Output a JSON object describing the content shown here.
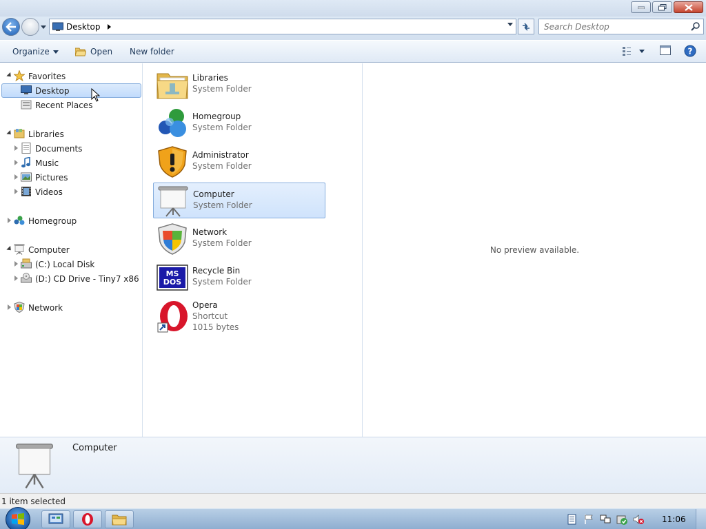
{
  "window": {
    "caption_buttons": [
      "minimize",
      "maximize",
      "close"
    ]
  },
  "address": {
    "location": "Desktop",
    "search_placeholder": "Search Desktop"
  },
  "toolbar": {
    "organize": "Organize",
    "open": "Open",
    "new_folder": "New folder"
  },
  "nav": {
    "favorites": "Favorites",
    "desktop": "Desktop",
    "recent_places": "Recent Places",
    "libraries": "Libraries",
    "documents": "Documents",
    "music": "Music",
    "pictures": "Pictures",
    "videos": "Videos",
    "homegroup": "Homegroup",
    "computer": "Computer",
    "local_disk": "(C:) Local Disk",
    "cd_drive": "(D:) CD Drive - Tiny7 x86",
    "network": "Network",
    "selected": "Desktop"
  },
  "files": [
    {
      "name": "Libraries",
      "type": "System Folder",
      "icon": "libraries-icon"
    },
    {
      "name": "Homegroup",
      "type": "System Folder",
      "icon": "homegroup-icon"
    },
    {
      "name": "Administrator",
      "type": "System Folder",
      "icon": "shield-warning-icon"
    },
    {
      "name": "Computer",
      "type": "System Folder",
      "icon": "projector-screen-icon",
      "selected": true
    },
    {
      "name": "Network",
      "type": "System Folder",
      "icon": "windows-shield-icon"
    },
    {
      "name": "Recycle Bin",
      "type": "System Folder",
      "icon": "ms-dos-icon"
    },
    {
      "name": "Opera",
      "type": "Shortcut",
      "size": "1015 bytes",
      "icon": "opera-icon"
    }
  ],
  "msdos_label": {
    "line1": "MS",
    "line2": "DOS"
  },
  "preview": {
    "message": "No preview available."
  },
  "details": {
    "name": "Computer"
  },
  "status": {
    "text": "1 item selected"
  },
  "taskbar": {
    "clock": "11:06"
  }
}
